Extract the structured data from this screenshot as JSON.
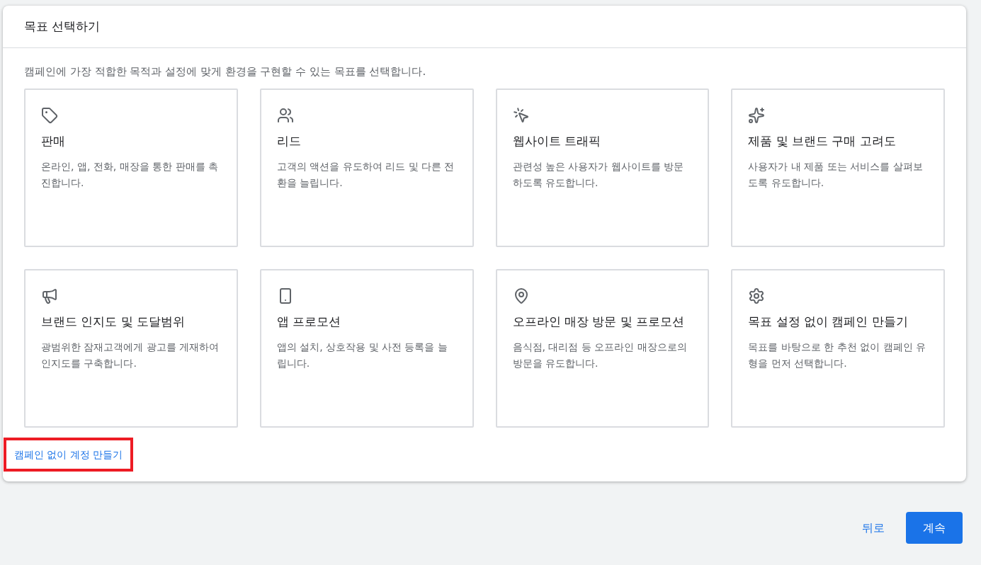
{
  "dialog": {
    "title": "목표 선택하기",
    "description": "캠페인에 가장 적합한 목적과 설정에 맞게 환경을 구현할 수 있는 목표를 선택합니다."
  },
  "goals": [
    {
      "title": "판매",
      "description": "온라인, 앱, 전화, 매장을 통한 판매를 촉진합니다."
    },
    {
      "title": "리드",
      "description": "고객의 액션을 유도하여 리드 및 다른 전환을 늘립니다."
    },
    {
      "title": "웹사이트 트래픽",
      "description": "관련성 높은 사용자가 웹사이트를 방문하도록 유도합니다."
    },
    {
      "title": "제품 및 브랜드 구매 고려도",
      "description": "사용자가 내 제품 또는 서비스를 살펴보도록 유도합니다."
    },
    {
      "title": "브랜드 인지도 및 도달범위",
      "description": "광범위한 잠재고객에게 광고를 게재하여 인지도를 구축합니다."
    },
    {
      "title": "앱 프로모션",
      "description": "앱의 설치, 상호작용 및 사전 등록을 늘립니다."
    },
    {
      "title": "오프라인 매장 방문 및 프로모션",
      "description": "음식점, 대리점 등 오프라인 매장으로의 방문을 유도합니다."
    },
    {
      "title": "목표 설정 없이 캠페인 만들기",
      "description": "목표를 바탕으로 한 추천 없이 캠페인 유형을 먼저 선택합니다."
    }
  ],
  "link": {
    "label": "캠페인 없이 계정 만들기",
    "highlighted": true
  },
  "footer": {
    "back": "뒤로",
    "continue": "계속"
  }
}
